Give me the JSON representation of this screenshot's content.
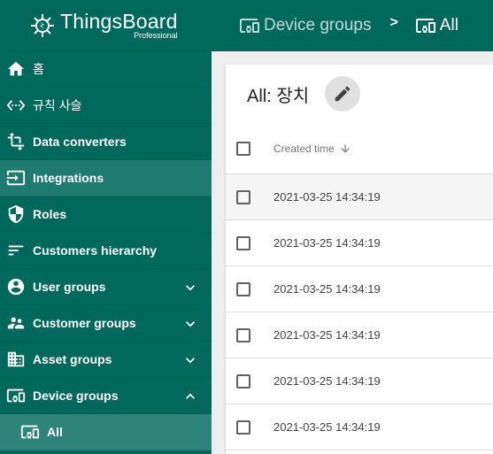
{
  "brand": {
    "title": "ThingsBoard",
    "subtitle": "Professional"
  },
  "sidebar": {
    "items": [
      {
        "label": "홈",
        "icon": "home-icon",
        "korean": true
      },
      {
        "label": "규칙 사슬",
        "icon": "settings-ethernet-icon",
        "korean": true
      },
      {
        "label": "Data converters",
        "icon": "transform-icon"
      },
      {
        "label": "Integrations",
        "icon": "input-icon",
        "active": true
      },
      {
        "label": "Roles",
        "icon": "security-icon"
      },
      {
        "label": "Customers hierarchy",
        "icon": "sort-icon"
      },
      {
        "label": "User groups",
        "icon": "account-circle-icon",
        "chevron": "down"
      },
      {
        "label": "Customer groups",
        "icon": "supervisor-account-icon",
        "chevron": "down"
      },
      {
        "label": "Asset groups",
        "icon": "domain-icon",
        "chevron": "down"
      },
      {
        "label": "Device groups",
        "icon": "devices-other-icon",
        "chevron": "up"
      }
    ],
    "sub_items": [
      {
        "label": "All",
        "icon": "devices-other-icon"
      }
    ]
  },
  "breadcrumb": {
    "first": "Device groups",
    "separator": ">",
    "last": "All"
  },
  "card": {
    "title": "All: 장치",
    "table": {
      "columns": [
        "Created time"
      ],
      "rows": [
        "2021-03-25 14:34:19",
        "2021-03-25 14:34:19",
        "2021-03-25 14:34:19",
        "2021-03-25 14:34:19",
        "2021-03-25 14:34:19",
        "2021-03-25 14:34:19"
      ]
    }
  },
  "colors": {
    "primary": "#00695c",
    "accent_bg": "#ffffff"
  }
}
